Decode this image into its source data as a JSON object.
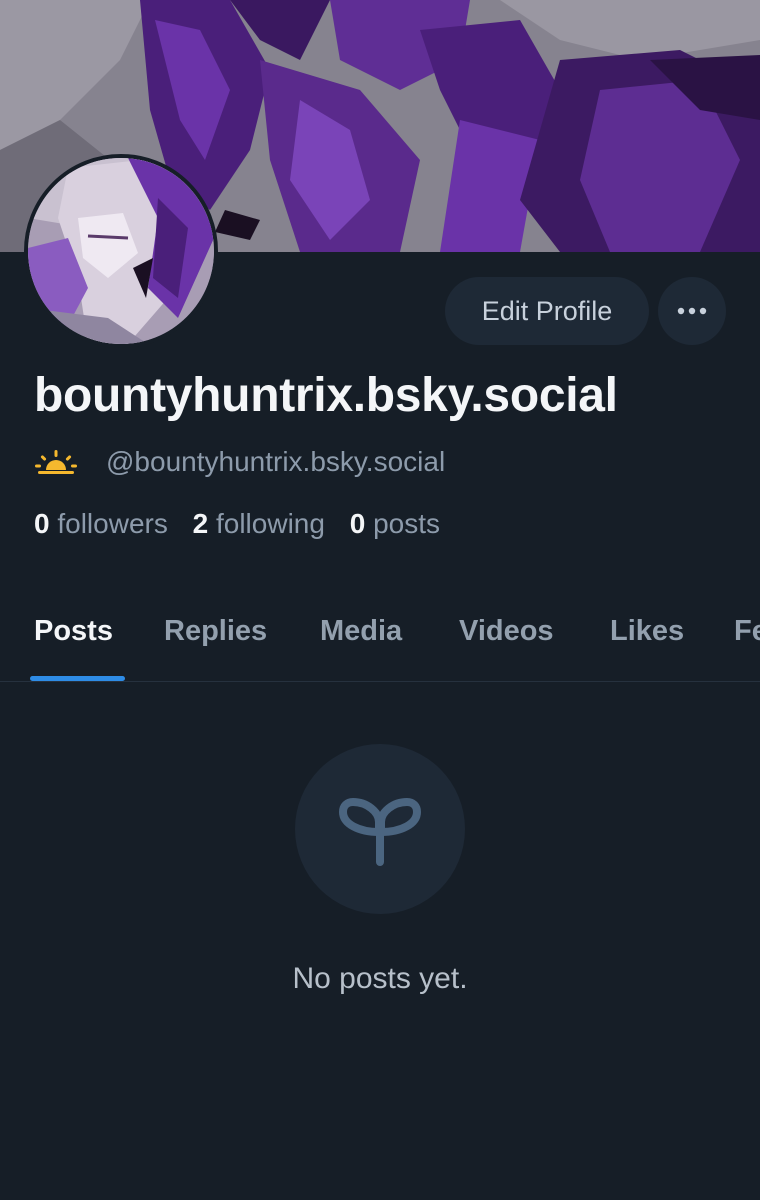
{
  "profile": {
    "display_name": "bountyhuntrix.bsky.social",
    "handle": "@bountyhuntrix.bsky.social",
    "status_icon": "sunrise-icon"
  },
  "actions": {
    "edit_label": "Edit Profile",
    "more_icon": "ellipsis-icon"
  },
  "stats": {
    "followers_count": "0",
    "followers_label": "followers",
    "following_count": "2",
    "following_label": "following",
    "posts_count": "0",
    "posts_label": "posts"
  },
  "tabs": [
    {
      "label": "Posts",
      "active": true
    },
    {
      "label": "Replies",
      "active": false
    },
    {
      "label": "Media",
      "active": false
    },
    {
      "label": "Videos",
      "active": false
    },
    {
      "label": "Likes",
      "active": false
    },
    {
      "label": "Fe",
      "active": false
    }
  ],
  "empty_state": {
    "icon": "seedling-icon",
    "message": "No posts yet."
  },
  "colors": {
    "background": "#161e27",
    "accent": "#2e8ce6",
    "button_bg": "#1e2936",
    "muted_text": "#8d9bab",
    "banner_purple": "#5a2a8c"
  }
}
